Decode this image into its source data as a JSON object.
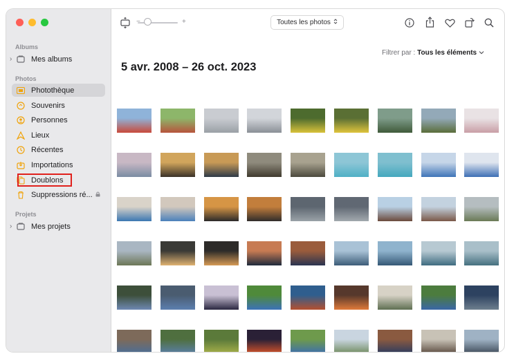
{
  "window": {
    "title": "Photos"
  },
  "traffic_colors": {
    "close": "#fe5f57",
    "minimize": "#febc2e",
    "zoom": "#28c840"
  },
  "sidebar": {
    "sections": [
      {
        "label": "Albums"
      },
      {
        "label": "Photos"
      },
      {
        "label": "Projets"
      }
    ],
    "albums_item": {
      "label": "Mes albums",
      "icon": "folder-icon"
    },
    "items": [
      {
        "label": "Photothèque",
        "icon": "library-icon",
        "selected": true
      },
      {
        "label": "Souvenirs",
        "icon": "memories-icon"
      },
      {
        "label": "Personnes",
        "icon": "people-icon"
      },
      {
        "label": "Lieux",
        "icon": "places-icon"
      },
      {
        "label": "Récentes",
        "icon": "clock-icon"
      },
      {
        "label": "Importations",
        "icon": "import-icon"
      },
      {
        "label": "Doublons",
        "icon": "duplicates-icon",
        "highlighted": true
      },
      {
        "label": "Suppressions ré...",
        "icon": "trash-icon",
        "locked": true
      }
    ],
    "projects_item": {
      "label": "Mes projets",
      "icon": "folder-icon"
    }
  },
  "toolbar": {
    "zoom_minus": "−",
    "zoom_plus": "+",
    "view_dropdown": "Toutes les photos",
    "icons": [
      "info-icon",
      "share-icon",
      "heart-icon",
      "rotate-icon",
      "search-icon"
    ]
  },
  "filter": {
    "label": "Filtrer par :",
    "value": "Tous les éléments"
  },
  "date_range": "5 avr. 2008 – 26 oct. 2023",
  "accent": "#f0a30a",
  "highlight_color": "#e0201c",
  "photos": [
    {
      "a": "#c94a3a",
      "b": "#8fb3d9"
    },
    {
      "a": "#b7543c",
      "b": "#8db66a"
    },
    {
      "a": "#9aa0a6",
      "b": "#c9ccd1"
    },
    {
      "a": "#8a8f96",
      "b": "#d2d5da"
    },
    {
      "a": "#d9c23a",
      "b": "#4d6b2e"
    },
    {
      "a": "#e0c43c",
      "b": "#5a6f34"
    },
    {
      "a": "#3f5a3a",
      "b": "#7f9c8a"
    },
    {
      "a": "#5a6d3a",
      "b": "#93a9b8"
    },
    {
      "a": "#c99ea5",
      "b": "#e9e2e4"
    },
    {
      "a": "#7a8ca3",
      "b": "#c8b8c4"
    },
    {
      "a": "#3a3228",
      "b": "#d1a55c"
    },
    {
      "a": "#2e3a48",
      "b": "#c89a56"
    },
    {
      "a": "#403a2e",
      "b": "#8f8b7d"
    },
    {
      "a": "#4c4a3d",
      "b": "#a8a28f"
    },
    {
      "a": "#4fb0c6",
      "b": "#8dc6d6"
    },
    {
      "a": "#44a8be",
      "b": "#7fbfcf"
    },
    {
      "a": "#3e74b8",
      "b": "#c6d6e8"
    },
    {
      "a": "#3d6fb5",
      "b": "#dfe5ee"
    },
    {
      "a": "#3b77b2",
      "b": "#d9d3c9"
    },
    {
      "a": "#4a80bb",
      "b": "#d2c8bd"
    },
    {
      "a": "#2b2a2a",
      "b": "#d69545"
    },
    {
      "a": "#2f2c2b",
      "b": "#c27e3c"
    },
    {
      "a": "#9aa2a8",
      "b": "#5d6670"
    },
    {
      "a": "#a2a9ae",
      "b": "#606873"
    },
    {
      "a": "#6b4a3c",
      "b": "#b9d0e4"
    },
    {
      "a": "#7a5848",
      "b": "#c3d2df"
    },
    {
      "a": "#6a7a56",
      "b": "#b5bdc0"
    },
    {
      "a": "#6c7656",
      "b": "#a9b6c2"
    },
    {
      "a": "#e0b271",
      "b": "#3a3a36"
    },
    {
      "a": "#d69a55",
      "b": "#2d2b29"
    },
    {
      "a": "#1f2a3c",
      "b": "#c77b53"
    },
    {
      "a": "#2a3450",
      "b": "#9a5c3c"
    },
    {
      "a": "#3c5c78",
      "b": "#a9c2d6"
    },
    {
      "a": "#355876",
      "b": "#8fb3cd"
    },
    {
      "a": "#3f6c80",
      "b": "#b7c9d2"
    },
    {
      "a": "#45707f",
      "b": "#a9bfc9"
    },
    {
      "a": "#6e88b2",
      "b": "#3d4f3a"
    },
    {
      "a": "#5c7fb0",
      "b": "#4a5c70"
    },
    {
      "a": "#2a2740",
      "b": "#c9c0d4"
    },
    {
      "a": "#3c72b8",
      "b": "#4f8a3a"
    },
    {
      "a": "#b5502f",
      "b": "#2f5e8e"
    },
    {
      "a": "#e07a3a",
      "b": "#56382c"
    },
    {
      "a": "#5e6f52",
      "b": "#d7d2c6"
    },
    {
      "a": "#3a67a6",
      "b": "#4c7c3e"
    },
    {
      "a": "#6e7f8e",
      "b": "#2d4260"
    },
    {
      "a": "#4a6e98",
      "b": "#7d6a5a"
    },
    {
      "a": "#5a7fa8",
      "b": "#4f6f3f"
    },
    {
      "a": "#a9b24a",
      "b": "#5b7a3a"
    },
    {
      "a": "#d9552a",
      "b": "#2a2036"
    },
    {
      "a": "#3b6db0",
      "b": "#6e9a4c"
    },
    {
      "a": "#6f8a5c",
      "b": "#c9d5e0"
    },
    {
      "a": "#2a3a60",
      "b": "#8a5a40"
    },
    {
      "a": "#5a4a3e",
      "b": "#c8c2b6"
    },
    {
      "a": "#3e4a58",
      "b": "#9fb2c4"
    }
  ]
}
